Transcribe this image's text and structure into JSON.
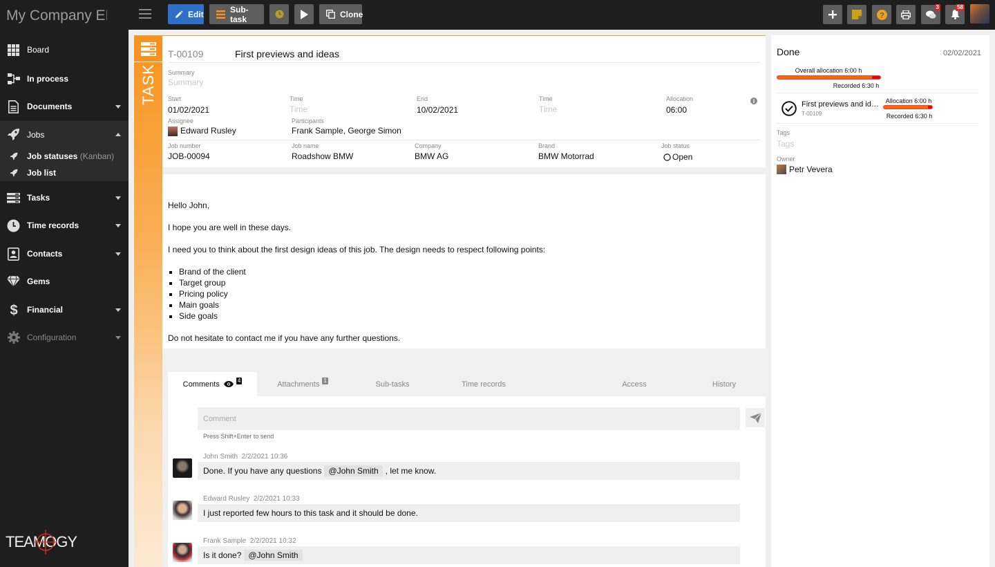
{
  "app": {
    "title": "My Company EI"
  },
  "toolbar": {
    "edit_label": "Edit",
    "subtask_label": "Sub-task",
    "clone_label": "Clone",
    "chat_badge": "3",
    "notif_badge": "58"
  },
  "sidebar": {
    "items": [
      {
        "label": "Board"
      },
      {
        "label": "In process"
      },
      {
        "label": "Documents"
      },
      {
        "label": "Jobs"
      },
      {
        "label": "Tasks"
      },
      {
        "label": "Time records"
      },
      {
        "label": "Contacts"
      },
      {
        "label": "Gems"
      },
      {
        "label": "Financial"
      },
      {
        "label": "Configuration"
      }
    ],
    "sub_items": [
      {
        "label": "Job statuses",
        "suffix": "(Kanban)"
      },
      {
        "label": "Job list"
      }
    ],
    "logo_text": "TEAMOGY"
  },
  "task": {
    "strip_label": "TASK",
    "id": "T-00109",
    "title": "First previews and ideas",
    "summary_label": "Summary",
    "summary_placeholder": "Summary",
    "start_label": "Start",
    "start_value": "01/02/2021",
    "time_label": "Time",
    "time_placeholder": "Time",
    "end_label": "End",
    "end_value": "10/02/2021",
    "time2_label": "Time",
    "time2_placeholder": "Time",
    "allocation_label": "Allocation",
    "allocation_value": "06:00",
    "assignee_label": "Assignee",
    "assignee_value": "Edward Rusley",
    "participants_label": "Participants",
    "participants_value": "Frank Sample, George Simon",
    "job_number_label": "Job number",
    "job_number_value": "JOB-00094",
    "job_name_label": "Job name",
    "job_name_value": "Roadshow BMW",
    "company_label": "Company",
    "company_value": "BMW AG",
    "brand_label": "Brand",
    "brand_value": "BMW Motorrad",
    "job_status_label": "Job status",
    "job_status_value": "Open"
  },
  "message": {
    "greeting": "Hello John,",
    "line1": "I hope you are well in these days.",
    "line2": "I need you to think about the first design ideas of this job. The design needs to respect following points:",
    "points": [
      "Brand of the client",
      "Target group",
      "Pricing policy",
      "Main goals",
      "Side goals"
    ],
    "closing": "Do not hesitate to contact me if you have any further questions."
  },
  "tabs": [
    {
      "label": "Comments",
      "badge": "4"
    },
    {
      "label": "Attachments",
      "badge": "1"
    },
    {
      "label": "Sub-tasks"
    },
    {
      "label": "Time records"
    },
    {
      "label": "Access"
    },
    {
      "label": "History"
    }
  ],
  "comments": {
    "placeholder": "Comment",
    "hint": "Press Shift+Enter to send",
    "items": [
      {
        "author": "John Smith",
        "date": "2/2/2021",
        "time": "10:36",
        "pre": "Done. If you have any questions",
        "mention": "@John Smith",
        "post": ", let me know."
      },
      {
        "author": "Edward Rusley",
        "date": "2/2/2021",
        "time": "10:33",
        "pre": "I just reported few hours to this task and it should be done.",
        "mention": "",
        "post": ""
      },
      {
        "author": "Frank Sample",
        "date": "2/2/2021",
        "time": "10:32",
        "pre": "Is it done?",
        "mention": "@John Smith",
        "post": ""
      }
    ]
  },
  "right_panel": {
    "status": "Done",
    "date": "02/02/2021",
    "overall_allocation": "Overall allocation 6:00 h",
    "overall_recorded": "Recorded 6:30 h",
    "subtask_title": "First previews and ideas",
    "subtask_id": "T-00109",
    "subtask_allocation": "Allocation 6:00 h",
    "subtask_recorded": "Recorded 6:30 h",
    "tags_label": "Tags",
    "tags_placeholder": "Tags",
    "owner_label": "Owner",
    "owner_value": "Petr Vevera"
  },
  "colors": {
    "accent_orange": "#f7931e",
    "edit_blue": "#2f6fc8",
    "badge_red": "#d42a2a"
  }
}
